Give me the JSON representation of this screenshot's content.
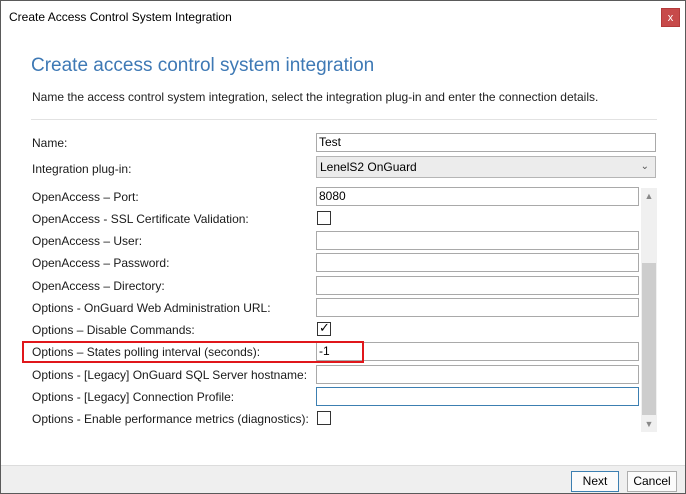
{
  "window": {
    "title": "Create Access Control System Integration",
    "close_glyph": "x"
  },
  "header": {
    "heading": "Create access control system integration",
    "subtitle": "Name the access control system integration, select the integration plug-in and enter the connection details."
  },
  "form": {
    "name_label": "Name:",
    "name_value": "Test",
    "plugin_label": "Integration plug-in:",
    "plugin_value": "LenelS2 OnGuard"
  },
  "properties": [
    {
      "label": "OpenAccess – Port:",
      "type": "text",
      "value": "8080"
    },
    {
      "label": "OpenAccess - SSL Certificate Validation:",
      "type": "checkbox",
      "checked": false
    },
    {
      "label": "OpenAccess – User:",
      "type": "text",
      "value": ""
    },
    {
      "label": "OpenAccess – Password:",
      "type": "text",
      "value": ""
    },
    {
      "label": "OpenAccess – Directory:",
      "type": "text",
      "value": ""
    },
    {
      "label": "Options - OnGuard Web Administration URL:",
      "type": "text",
      "value": ""
    },
    {
      "label": "Options – Disable Commands:",
      "type": "checkbox",
      "checked": true
    },
    {
      "label": "Options – States polling interval (seconds):",
      "type": "text",
      "value": "-1"
    },
    {
      "label": "Options - [Legacy] OnGuard SQL Server hostname:",
      "type": "text",
      "value": ""
    },
    {
      "label": "Options - [Legacy] Connection Profile:",
      "type": "text",
      "value": ""
    },
    {
      "label": "Options - Enable performance metrics (diagnostics):",
      "type": "checkbox",
      "checked": false
    }
  ],
  "footer": {
    "next_label": "Next",
    "cancel_label": "Cancel"
  },
  "icons": {
    "checkmark": "✓",
    "chevron_down": "⌄",
    "scroll_up": "▲",
    "scroll_down": "▼"
  }
}
